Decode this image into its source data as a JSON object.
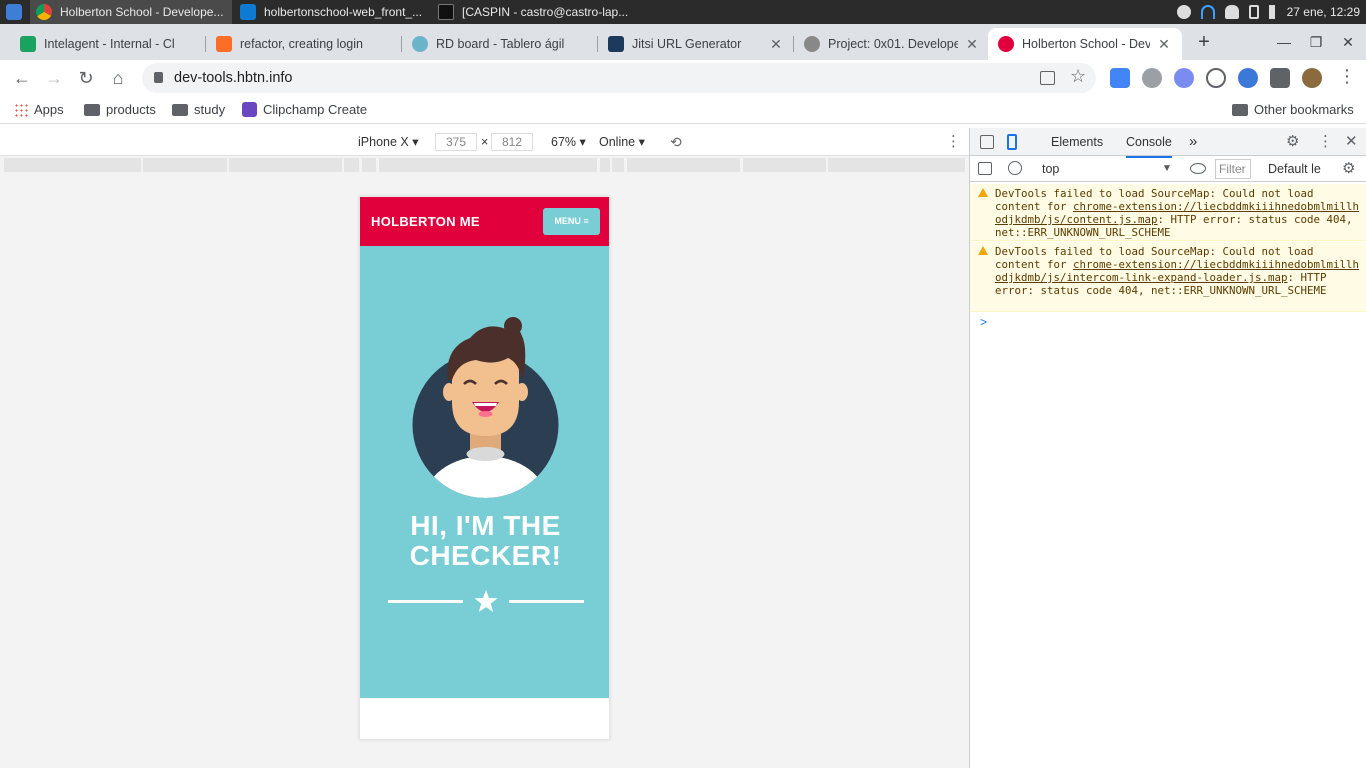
{
  "taskbar": {
    "apps": [
      {
        "title": "Holberton School - Develope..."
      },
      {
        "title": "holbertonschool-web_front_..."
      },
      {
        "title": "[CASPIN - castro@castro-lap..."
      }
    ],
    "clock": "27 ene, 12:29"
  },
  "browser": {
    "tabs": [
      {
        "title": "Intelagent - Internal - Cl"
      },
      {
        "title": "refactor, creating login"
      },
      {
        "title": "RD board - Tablero ágil"
      },
      {
        "title": "Jitsi URL Generator"
      },
      {
        "title": "Project: 0x01. Develope"
      },
      {
        "title": "Holberton School - Dev"
      }
    ],
    "url": "dev-tools.hbtn.info",
    "bookmarks": [
      "Apps",
      "products",
      "study",
      "Clipchamp Create"
    ],
    "other_bookmarks": "Other bookmarks"
  },
  "device_toolbar": {
    "device": "iPhone X",
    "width": "375",
    "times": "×",
    "height": "812",
    "zoom": "67%",
    "network": "Online"
  },
  "site": {
    "logo": "HOLBERTON ME",
    "menu_label": "MENU ≡",
    "hero_title_line1": "HI, I'M THE",
    "hero_title_line2": "CHECKER!",
    "colors": {
      "header": "#e1003c",
      "hero": "#78ced4"
    }
  },
  "devtools": {
    "tabs": [
      "Elements",
      "Console"
    ],
    "active_tab": "Console",
    "context": "top",
    "filter_placeholder": "Filter",
    "levels": "Default le",
    "messages": [
      {
        "prefix": "DevTools failed to load SourceMap: Could not load content for ",
        "link": "chrome-extension://liecbddmkiiihnedobmlmillhodjkdmb/js/content.js.map",
        "suffix": ": HTTP error: status code 404, net::ERR_UNKNOWN_URL_SCHEME"
      },
      {
        "prefix": "DevTools failed to load SourceMap: Could not load content for ",
        "link": "chrome-extension://liecbddmkiiihnedobmlmillhodjkdmb/js/intercom-link-expand-loader.js.map",
        "suffix": ": HTTP error: status code 404, net::ERR_UNKNOWN_URL_SCHEME"
      }
    ],
    "prompt": ">"
  }
}
